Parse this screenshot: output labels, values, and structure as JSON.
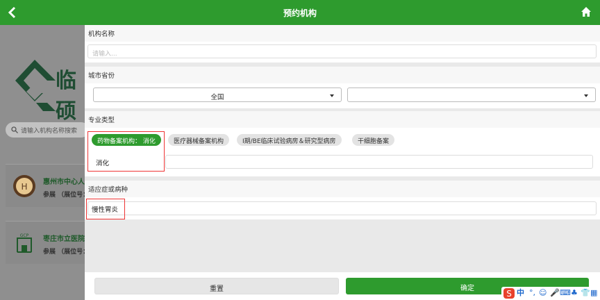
{
  "header": {
    "title": "预约机构",
    "back_icon": "chevron-left-icon",
    "home_icon": "home-icon",
    "color": "#2e9b2e"
  },
  "background_page": {
    "logo_text": "临硕",
    "search_placeholder": "请输入机构名称搜索",
    "cards": [
      {
        "name": "惠州市中心人民医院",
        "sub": "参展 （展位号："
      },
      {
        "name": "枣庄市立医院",
        "sub": "参展 （展位号："
      }
    ]
  },
  "filter": {
    "institution": {
      "label": "机构名称",
      "placeholder": "请输入..."
    },
    "city": {
      "label": "城市省份",
      "province_value": "全国",
      "city_value": ""
    },
    "specialty": {
      "label": "专业类型",
      "chips": [
        "药物备案机构： 消化",
        "医疗器械备案机构",
        "I期/BE临床试验病房＆研究型病房",
        "干细胞备案"
      ],
      "selected_value": "消化"
    },
    "indication": {
      "label": "适应症或病种",
      "value": "慢性胃炎"
    },
    "buttons": {
      "reset": "重置",
      "confirm": "确定"
    }
  },
  "ime_toolbar": {
    "mode": "中"
  }
}
